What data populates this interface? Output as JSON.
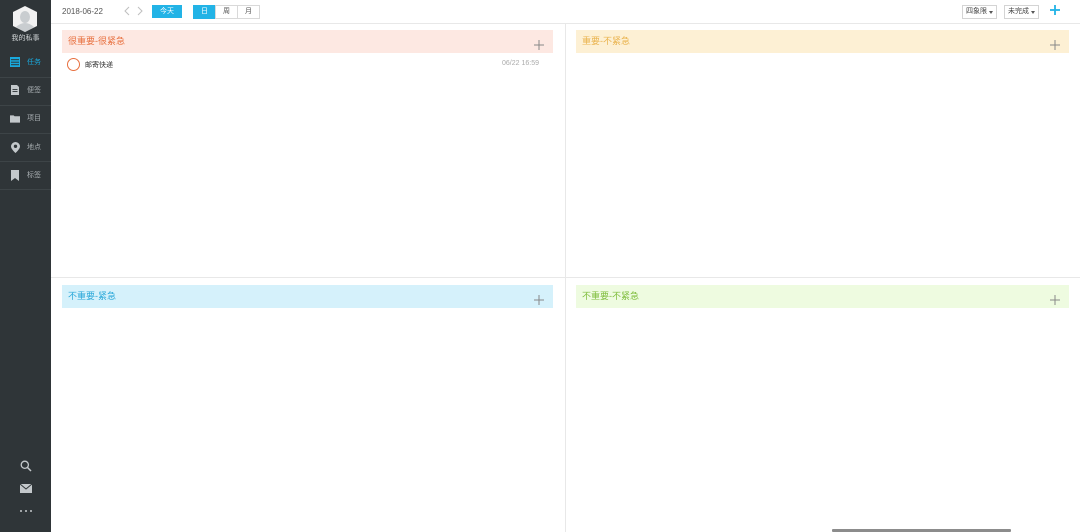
{
  "app": {
    "name": "我的私事"
  },
  "sidebar": {
    "items": [
      {
        "label": "任务",
        "icon": "table-icon",
        "active": true
      },
      {
        "label": "便签",
        "icon": "note-icon",
        "active": false
      },
      {
        "label": "项目",
        "icon": "folder-icon",
        "active": false
      },
      {
        "label": "地点",
        "icon": "location-pin-icon",
        "active": false
      },
      {
        "label": "标签",
        "icon": "bookmark-icon",
        "active": false
      }
    ],
    "bottom": [
      "search-icon",
      "mail-icon",
      "more-icon"
    ]
  },
  "toolbar": {
    "date": "2018-06-22",
    "today_label": "今天",
    "views": [
      {
        "label": "日",
        "active": true
      },
      {
        "label": "周",
        "active": false
      },
      {
        "label": "月",
        "active": false
      }
    ],
    "layout_select": "四象限",
    "status_select": "未完成"
  },
  "quadrants": [
    {
      "title": "很重要-很紧急",
      "color": "#e8703f",
      "bg": "#fde8e2"
    },
    {
      "title": "重要-不紧急",
      "color": "#eab34e",
      "bg": "#fdf0d4"
    },
    {
      "title": "不重要-紧急",
      "color": "#2aa8d9",
      "bg": "#d5f1fb"
    },
    {
      "title": "不重要-不紧急",
      "color": "#7fbd3c",
      "bg": "#eefbe0"
    }
  ],
  "tasks": [
    {
      "title": "邮寄快递",
      "time": "06/22 16:59",
      "quadrant": 0,
      "done": false
    }
  ],
  "colors": {
    "accent": "#22b3e6",
    "sidebar_bg": "#2f3538"
  }
}
